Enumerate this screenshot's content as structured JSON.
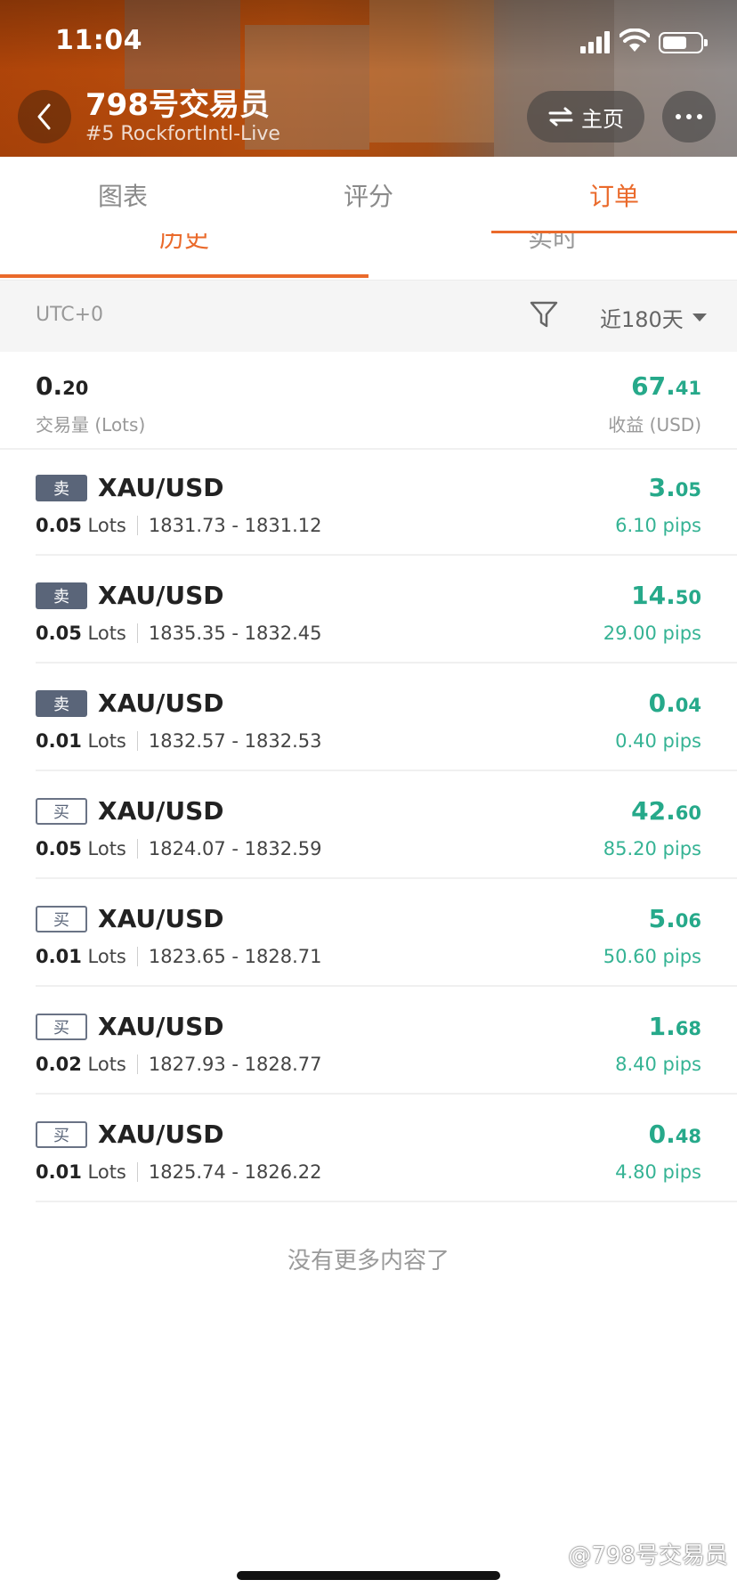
{
  "status_bar": {
    "time": "11:04"
  },
  "header": {
    "trader_name": "798号交易员",
    "account": "#5 RockfortIntl-Live",
    "home_label": "主页"
  },
  "main_tabs": [
    {
      "label": "图表",
      "active": false
    },
    {
      "label": "评分",
      "active": false
    },
    {
      "label": "订单",
      "active": true
    }
  ],
  "sub_tabs": [
    {
      "label": "历史",
      "active": true
    },
    {
      "label": "实时",
      "active": false
    }
  ],
  "filter": {
    "timezone": "UTC+0",
    "period": "近180天"
  },
  "summary": {
    "volume_int": "0.",
    "volume_dec": "20",
    "volume_label": "交易量 (Lots)",
    "profit_int": "67.",
    "profit_dec": "41",
    "profit_label": "收益 (USD)"
  },
  "orders": [
    {
      "side": "卖",
      "type": "sell",
      "symbol": "XAU/USD",
      "lots": "0.05",
      "lots_unit": "Lots",
      "prices": "1831.73 - 1831.12",
      "profit_int": "3.",
      "profit_dec": "05",
      "pips": "6.10 pips"
    },
    {
      "side": "卖",
      "type": "sell",
      "symbol": "XAU/USD",
      "lots": "0.05",
      "lots_unit": "Lots",
      "prices": "1835.35 - 1832.45",
      "profit_int": "14.",
      "profit_dec": "50",
      "pips": "29.00 pips"
    },
    {
      "side": "卖",
      "type": "sell",
      "symbol": "XAU/USD",
      "lots": "0.01",
      "lots_unit": "Lots",
      "prices": "1832.57 - 1832.53",
      "profit_int": "0.",
      "profit_dec": "04",
      "pips": "0.40 pips"
    },
    {
      "side": "买",
      "type": "buy",
      "symbol": "XAU/USD",
      "lots": "0.05",
      "lots_unit": "Lots",
      "prices": "1824.07 - 1832.59",
      "profit_int": "42.",
      "profit_dec": "60",
      "pips": "85.20 pips"
    },
    {
      "side": "买",
      "type": "buy",
      "symbol": "XAU/USD",
      "lots": "0.01",
      "lots_unit": "Lots",
      "prices": "1823.65 - 1828.71",
      "profit_int": "5.",
      "profit_dec": "06",
      "pips": "50.60 pips"
    },
    {
      "side": "买",
      "type": "buy",
      "symbol": "XAU/USD",
      "lots": "0.02",
      "lots_unit": "Lots",
      "prices": "1827.93 - 1828.77",
      "profit_int": "1.",
      "profit_dec": "68",
      "pips": "8.40 pips"
    },
    {
      "side": "买",
      "type": "buy",
      "symbol": "XAU/USD",
      "lots": "0.01",
      "lots_unit": "Lots",
      "prices": "1825.74 - 1826.22",
      "profit_int": "0.",
      "profit_dec": "48",
      "pips": "4.80 pips"
    }
  ],
  "end_text": "没有更多内容了",
  "watermark": "@798号交易员",
  "colors": {
    "accent": "#ea6a2b",
    "profit": "#26a98a",
    "sell_badge": "#5a6579"
  }
}
